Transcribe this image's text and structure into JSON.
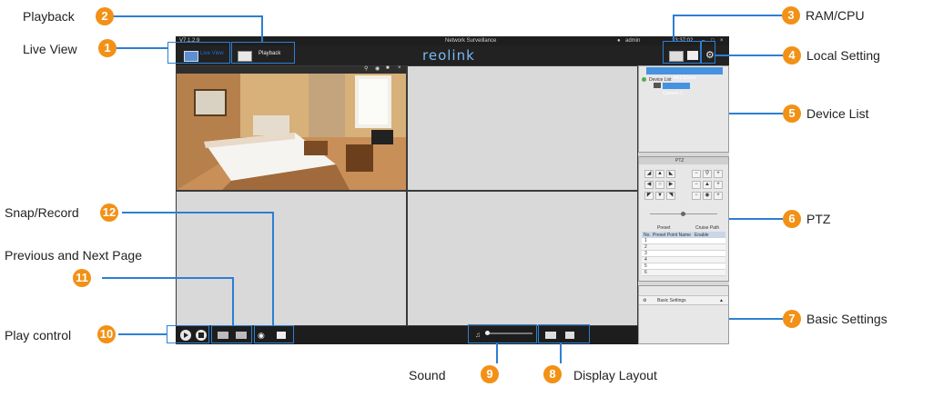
{
  "callouts": {
    "playback": {
      "num": "2",
      "label": "Playback"
    },
    "live_view": {
      "num": "1",
      "label": "Live View"
    },
    "ram_cpu": {
      "num": "3",
      "label": "RAM/CPU"
    },
    "local_setting": {
      "num": "4",
      "label": "Local Setting"
    },
    "device_list": {
      "num": "5",
      "label": "Device List"
    },
    "ptz": {
      "num": "6",
      "label": "PTZ"
    },
    "basic_settings": {
      "num": "7",
      "label": "Basic Settings"
    },
    "display_layout": {
      "num": "8",
      "label": "Display Layout"
    },
    "sound": {
      "num": "9",
      "label": "Sound"
    },
    "play_control": {
      "num": "10",
      "label": "Play control"
    },
    "prev_next_page": {
      "num": "11",
      "label": "Previous and Next Page"
    },
    "snap_record": {
      "num": "12",
      "label": "Snap/Record"
    }
  },
  "app": {
    "version": "V7.1.2.9",
    "window_title": "Network Surveillance",
    "user": "admin",
    "time": "13:37:02",
    "brand": "reolink",
    "tabs": {
      "live": "Live View",
      "playback": "Playback"
    },
    "device_panel": {
      "add_device": "Add Device",
      "device_list": "Device List",
      "camera": "Camera 1"
    },
    "ptz": {
      "header": "PTZ",
      "tab_preset": "Preset",
      "tab_cruise": "Cruise Path",
      "col_no": "No.",
      "col_preset": "Preset Point Name",
      "col_enable": "Enable",
      "rows": [
        "1",
        "2",
        "3",
        "4",
        "5",
        "6"
      ]
    },
    "basic_settings": {
      "label": "Basic Settings"
    }
  },
  "colors": {
    "accent": "#f29116",
    "highlight": "#2d7fd3",
    "app_dark": "#1e1e1e",
    "tab_active": "#1e6fd0"
  }
}
